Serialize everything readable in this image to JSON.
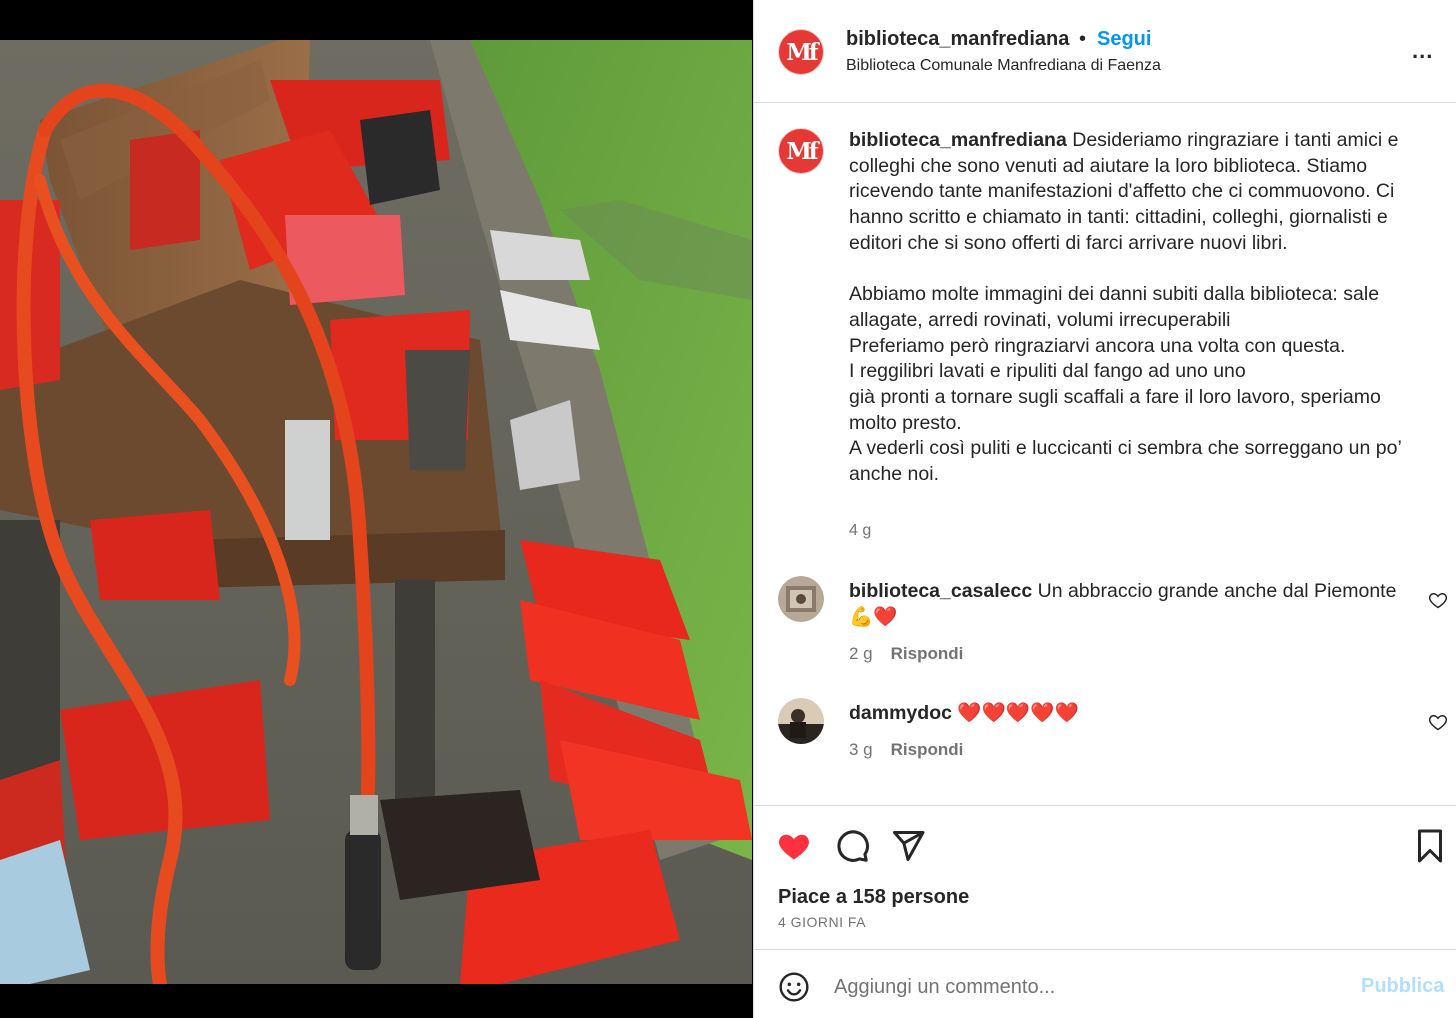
{
  "photo": {
    "alt_icon": "photo-image"
  },
  "header": {
    "avatar_text": "Mf",
    "username": "biblioteca_manfrediana",
    "separator": "•",
    "follow_label": "Segui",
    "subtitle": "Biblioteca Comunale Manfrediana di Faenza",
    "more_label": "..."
  },
  "caption": {
    "avatar_text": "Mf",
    "username": "biblioteca_manfrediana",
    "text": " Desideriamo ringraziare i tanti amici e colleghi che sono venuti ad aiutare la loro biblioteca. Stiamo ricevendo tante manifestazioni d'affetto che ci commuovono. Ci hanno scritto e chiamato in tanti: cittadini, colleghi, giornalisti e editori che si sono offerti di farci arrivare nuovi libri.\n\nAbbiamo molte immagini dei danni subiti dalla biblioteca: sale allagate, arredi rovinati, volumi irrecuperabili\nPreferiamo però ringraziarvi ancora una volta con questa.\nI reggilibri lavati e ripuliti dal fango ad uno uno\ngià pronti a tornare sugli scaffali a fare il loro lavoro, speriamo molto presto.\nA vederli così puliti e luccicanti ci sembra che sorreggano un po’ anche noi.",
    "time": "4 g"
  },
  "comments": [
    {
      "username": "biblioteca_casalecc",
      "text": " Un abbraccio grande anche dal Piemonte 💪❤️",
      "time": "2 g",
      "reply": "Rispondi"
    },
    {
      "username": "dammydoc",
      "text": " ❤️❤️❤️❤️❤️",
      "time": "3 g",
      "reply": "Rispondi"
    }
  ],
  "actions": {
    "likes": "Piace a 158 persone",
    "ago": "4 GIORNI FA"
  },
  "composer": {
    "placeholder": "Aggiungi un commento...",
    "publish_label": "Pubblica"
  },
  "colors": {
    "accent": "#0095f6",
    "like_red": "#ff3040",
    "brand_red": "#e53935"
  }
}
